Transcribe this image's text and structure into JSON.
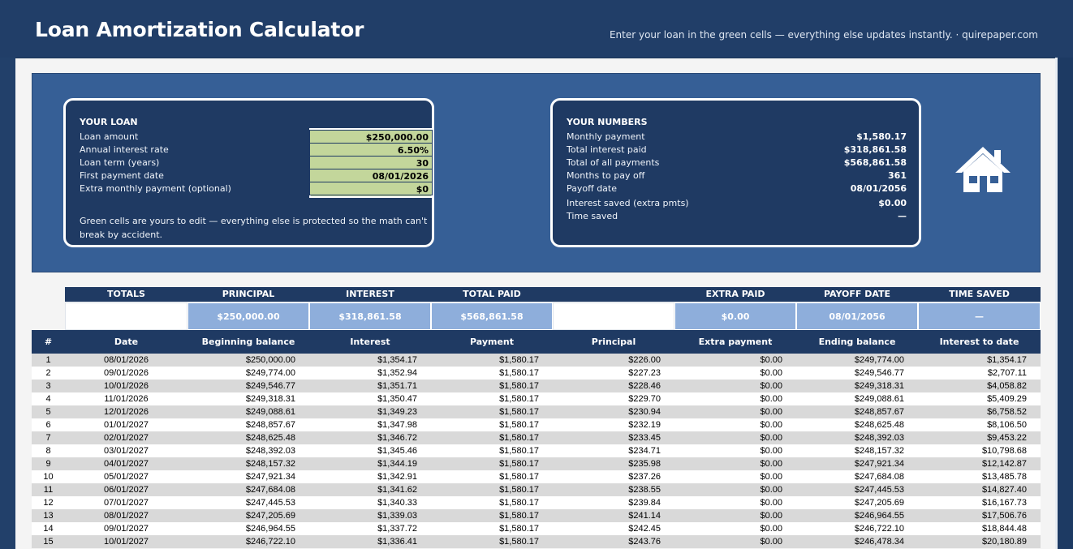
{
  "header": {
    "title": "Loan Amortization Calculator",
    "subtitle": "Enter your loan in the green cells — everything else updates instantly.  ·  quirepaper.com"
  },
  "loan_card": {
    "heading": "YOUR LOAN",
    "fields": [
      {
        "label": "Loan amount",
        "value": "$250,000.00"
      },
      {
        "label": "Annual interest rate",
        "value": "6.50%"
      },
      {
        "label": "Loan term (years)",
        "value": "30"
      },
      {
        "label": "First payment date",
        "value": "08/01/2026"
      },
      {
        "label": "Extra monthly payment (optional)",
        "value": "$0"
      }
    ],
    "note": "Green cells are yours to edit — everything else is protected so the math can't break by accident."
  },
  "numbers_card": {
    "heading": "YOUR NUMBERS",
    "items": [
      {
        "label": "Monthly payment",
        "value": "$1,580.17"
      },
      {
        "label": "Total interest paid",
        "value": "$318,861.58"
      },
      {
        "label": "Total of all payments",
        "value": "$568,861.58"
      },
      {
        "label": "Months to pay off",
        "value": "361"
      },
      {
        "label": "Payoff date",
        "value": "08/01/2056"
      },
      {
        "label": "Interest saved (extra pmts)",
        "value": "$0.00"
      },
      {
        "label": "Time saved",
        "value": "—"
      }
    ]
  },
  "icon": "house-icon",
  "totals": {
    "headers": [
      "TOTALS",
      "PRINCIPAL",
      "INTEREST",
      "TOTAL PAID",
      "",
      "EXTRA PAID",
      "PAYOFF DATE",
      "TIME SAVED"
    ],
    "values": [
      "",
      "$250,000.00",
      "$318,861.58",
      "$568,861.58",
      "",
      "$0.00",
      "08/01/2056",
      "—"
    ]
  },
  "schedule": {
    "columns": [
      "#",
      "Date",
      "Beginning balance",
      "Interest",
      "Payment",
      "Principal",
      "Extra payment",
      "Ending balance",
      "Interest to date"
    ],
    "rows": [
      [
        "1",
        "08/01/2026",
        "$250,000.00",
        "$1,354.17",
        "$1,580.17",
        "$226.00",
        "$0.00",
        "$249,774.00",
        "$1,354.17"
      ],
      [
        "2",
        "09/01/2026",
        "$249,774.00",
        "$1,352.94",
        "$1,580.17",
        "$227.23",
        "$0.00",
        "$249,546.77",
        "$2,707.11"
      ],
      [
        "3",
        "10/01/2026",
        "$249,546.77",
        "$1,351.71",
        "$1,580.17",
        "$228.46",
        "$0.00",
        "$249,318.31",
        "$4,058.82"
      ],
      [
        "4",
        "11/01/2026",
        "$249,318.31",
        "$1,350.47",
        "$1,580.17",
        "$229.70",
        "$0.00",
        "$249,088.61",
        "$5,409.29"
      ],
      [
        "5",
        "12/01/2026",
        "$249,088.61",
        "$1,349.23",
        "$1,580.17",
        "$230.94",
        "$0.00",
        "$248,857.67",
        "$6,758.52"
      ],
      [
        "6",
        "01/01/2027",
        "$248,857.67",
        "$1,347.98",
        "$1,580.17",
        "$232.19",
        "$0.00",
        "$248,625.48",
        "$8,106.50"
      ],
      [
        "7",
        "02/01/2027",
        "$248,625.48",
        "$1,346.72",
        "$1,580.17",
        "$233.45",
        "$0.00",
        "$248,392.03",
        "$9,453.22"
      ],
      [
        "8",
        "03/01/2027",
        "$248,392.03",
        "$1,345.46",
        "$1,580.17",
        "$234.71",
        "$0.00",
        "$248,157.32",
        "$10,798.68"
      ],
      [
        "9",
        "04/01/2027",
        "$248,157.32",
        "$1,344.19",
        "$1,580.17",
        "$235.98",
        "$0.00",
        "$247,921.34",
        "$12,142.87"
      ],
      [
        "10",
        "05/01/2027",
        "$247,921.34",
        "$1,342.91",
        "$1,580.17",
        "$237.26",
        "$0.00",
        "$247,684.08",
        "$13,485.78"
      ],
      [
        "11",
        "06/01/2027",
        "$247,684.08",
        "$1,341.62",
        "$1,580.17",
        "$238.55",
        "$0.00",
        "$247,445.53",
        "$14,827.40"
      ],
      [
        "12",
        "07/01/2027",
        "$247,445.53",
        "$1,340.33",
        "$1,580.17",
        "$239.84",
        "$0.00",
        "$247,205.69",
        "$16,167.73"
      ],
      [
        "13",
        "08/01/2027",
        "$247,205.69",
        "$1,339.03",
        "$1,580.17",
        "$241.14",
        "$0.00",
        "$246,964.55",
        "$17,506.76"
      ],
      [
        "14",
        "09/01/2027",
        "$246,964.55",
        "$1,337.72",
        "$1,580.17",
        "$242.45",
        "$0.00",
        "$246,722.10",
        "$18,844.48"
      ],
      [
        "15",
        "10/01/2027",
        "$246,722.10",
        "$1,336.41",
        "$1,580.17",
        "$243.76",
        "$0.00",
        "$246,478.34",
        "$20,180.89"
      ]
    ]
  }
}
